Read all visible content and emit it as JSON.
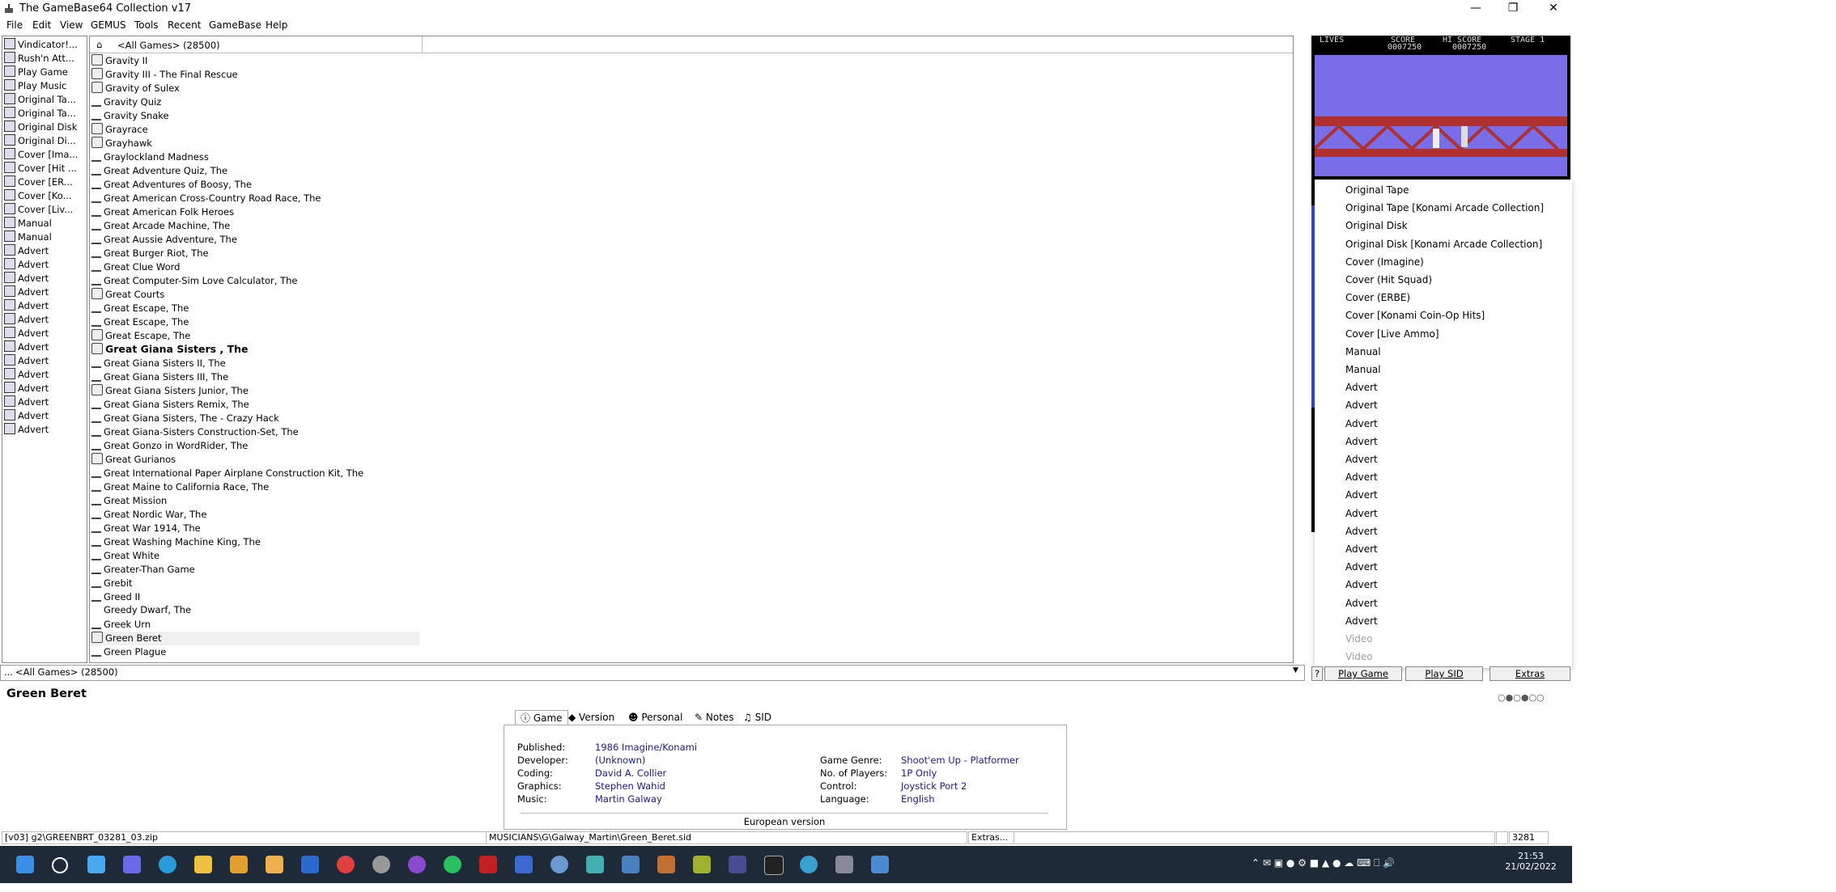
{
  "window": {
    "title": "The GameBase64 Collection v17"
  },
  "menu": [
    "File",
    "Edit",
    "View",
    "GEMUS",
    "Tools",
    "Recent",
    "GameBase",
    "Help"
  ],
  "left_items": [
    {
      "label": "Vindicator!...",
      "icon": "vindicator-icon"
    },
    {
      "label": "Rush'n Att...",
      "icon": "rush-icon"
    },
    {
      "label": "Play Game",
      "icon": "joystick-icon"
    },
    {
      "label": "Play Music",
      "icon": "music-icon"
    },
    {
      "label": "Original Ta...",
      "icon": "tape-icon"
    },
    {
      "label": "Original Ta...",
      "icon": "joystick-icon"
    },
    {
      "label": "Original Disk",
      "icon": "disk-icon"
    },
    {
      "label": "Original Di...",
      "icon": "joystick-icon"
    },
    {
      "label": "Cover [Ima...",
      "icon": "image-icon"
    },
    {
      "label": "Cover [Hit ...",
      "icon": "image-icon"
    },
    {
      "label": "Cover [ER...",
      "icon": "image-icon"
    },
    {
      "label": "Cover [Ko...",
      "icon": "image-icon"
    },
    {
      "label": "Cover [Liv...",
      "icon": "image-icon"
    },
    {
      "label": "Manual",
      "icon": "book-icon"
    },
    {
      "label": "Manual",
      "icon": "book-icon"
    },
    {
      "label": "Advert",
      "icon": "image-icon"
    },
    {
      "label": "Advert",
      "icon": "image-icon"
    },
    {
      "label": "Advert",
      "icon": "image-icon"
    },
    {
      "label": "Advert",
      "icon": "image-icon"
    },
    {
      "label": "Advert",
      "icon": "image-icon"
    },
    {
      "label": "Advert",
      "icon": "image-icon"
    },
    {
      "label": "Advert",
      "icon": "image-icon"
    },
    {
      "label": "Advert",
      "icon": "image-icon"
    },
    {
      "label": "Advert",
      "icon": "image-icon"
    },
    {
      "label": "Advert",
      "icon": "image-icon"
    },
    {
      "label": "Advert",
      "icon": "image-icon"
    },
    {
      "label": "Advert",
      "icon": "image-icon"
    },
    {
      "label": "Advert",
      "icon": "image-icon"
    },
    {
      "label": "Advert",
      "icon": "image-icon"
    }
  ],
  "gamelist": {
    "header": "<All Games>  (28500)",
    "rows": [
      {
        "title": "Gravity II",
        "icon": "disk"
      },
      {
        "title": "Gravity III - The Final Rescue",
        "icon": "disk"
      },
      {
        "title": "Gravity of Sulex",
        "icon": "disk"
      },
      {
        "title": "Gravity Quiz",
        "icon": "joy"
      },
      {
        "title": "Gravity Snake",
        "icon": "joy"
      },
      {
        "title": "Grayrace",
        "icon": "disk"
      },
      {
        "title": "Grayhawk",
        "icon": "disk"
      },
      {
        "title": "Graylockland Madness",
        "icon": "joy"
      },
      {
        "title": "Great Adventure Quiz, The",
        "icon": "joy"
      },
      {
        "title": "Great Adventures of Boosy, The",
        "icon": "joy"
      },
      {
        "title": "Great American Cross-Country Road Race, The",
        "icon": "joy"
      },
      {
        "title": "Great American Folk Heroes",
        "icon": "joy"
      },
      {
        "title": "Great Arcade Machine, The",
        "icon": "joy"
      },
      {
        "title": "Great Aussie Adventure, The",
        "icon": "joy"
      },
      {
        "title": "Great Burger Riot, The",
        "icon": "joy"
      },
      {
        "title": "Great Clue Word",
        "icon": "joy"
      },
      {
        "title": "Great Computer-Sim Love Calculator, The",
        "icon": "joy"
      },
      {
        "title": "Great Courts",
        "icon": "disk"
      },
      {
        "title": "Great Escape, The",
        "icon": "joy"
      },
      {
        "title": "Great Escape, The",
        "icon": "joy"
      },
      {
        "title": "Great Escape, The",
        "icon": "disk"
      },
      {
        "title": "Great Giana Sisters , The",
        "icon": "disk",
        "bold": true
      },
      {
        "title": "Great Giana Sisters II, The",
        "icon": "joy"
      },
      {
        "title": "Great Giana Sisters III, The",
        "icon": "joy"
      },
      {
        "title": "Great Giana Sisters Junior, The",
        "icon": "disk"
      },
      {
        "title": "Great Giana Sisters Remix, The",
        "icon": "joy"
      },
      {
        "title": "Great Giana Sisters, The - Crazy Hack",
        "icon": "joy"
      },
      {
        "title": "Great Giana-Sisters Construction-Set, The",
        "icon": "joy"
      },
      {
        "title": "Great Gonzo in WordRider, The",
        "icon": "joy"
      },
      {
        "title": "Great Gurianos",
        "icon": "disk"
      },
      {
        "title": "Great International Paper Airplane Construction Kit, The",
        "icon": "joy"
      },
      {
        "title": "Great Maine to California Race, The",
        "icon": "joy"
      },
      {
        "title": "Great Mission",
        "icon": "joy"
      },
      {
        "title": "Great Nordic War, The",
        "icon": "joy"
      },
      {
        "title": "Great War 1914, The",
        "icon": "joy"
      },
      {
        "title": "Great Washing Machine King, The",
        "icon": "joy"
      },
      {
        "title": "Great White",
        "icon": "joy"
      },
      {
        "title": "Greater-Than Game",
        "icon": "joy"
      },
      {
        "title": "Grebit",
        "icon": "joy"
      },
      {
        "title": "Greed II",
        "icon": "joy"
      },
      {
        "title": "Greedy Dwarf, The",
        "icon": "none"
      },
      {
        "title": "Greek Urn",
        "icon": "joy"
      },
      {
        "title": "Green Beret",
        "icon": "disk",
        "selected": true
      },
      {
        "title": "Green Plague",
        "icon": "joy"
      }
    ]
  },
  "filterbar": {
    "label": "<All Games>  (28500)"
  },
  "screen": {
    "hud_lives": "LIVES",
    "hud_score": "SCORE",
    "hud_hiscore": "HI  SCORE",
    "hud_stage": "STAGE 1",
    "score_value": "0007250",
    "hiscore_value": "0007250"
  },
  "extras_menu": {
    "items": [
      {
        "label": "Original Tape",
        "disabled": false
      },
      {
        "label": "Original Tape [Konami Arcade Collection]",
        "disabled": false
      },
      {
        "label": "Original Disk",
        "disabled": false
      },
      {
        "label": "Original Disk [Konami Arcade Collection]",
        "disabled": false
      },
      {
        "label": "Cover (Imagine)",
        "disabled": false
      },
      {
        "label": "Cover (Hit Squad)",
        "disabled": false
      },
      {
        "label": "Cover (ERBE)",
        "disabled": false
      },
      {
        "label": "Cover [Konami Coin-Op Hits]",
        "disabled": false
      },
      {
        "label": "Cover [Live Ammo]",
        "disabled": false
      },
      {
        "label": "Manual",
        "disabled": false
      },
      {
        "label": "Manual",
        "disabled": false
      },
      {
        "label": "Advert",
        "disabled": false
      },
      {
        "label": "Advert",
        "disabled": false
      },
      {
        "label": "Advert",
        "disabled": false
      },
      {
        "label": "Advert",
        "disabled": false
      },
      {
        "label": "Advert",
        "disabled": false
      },
      {
        "label": "Advert",
        "disabled": false
      },
      {
        "label": "Advert",
        "disabled": false
      },
      {
        "label": "Advert",
        "disabled": false
      },
      {
        "label": "Advert",
        "disabled": false
      },
      {
        "label": "Advert",
        "disabled": false
      },
      {
        "label": "Advert",
        "disabled": false
      },
      {
        "label": "Advert",
        "disabled": false
      },
      {
        "label": "Advert",
        "disabled": false
      },
      {
        "label": "Advert",
        "disabled": false
      },
      {
        "label": "Video",
        "disabled": true
      },
      {
        "label": "Video",
        "disabled": true
      }
    ]
  },
  "buttons": {
    "help": "?",
    "play_game": "Play Game",
    "play_sid": "Play SID",
    "extras": "Extras"
  },
  "game": {
    "name": "Green Beret",
    "tabs": [
      "Game",
      "Version",
      "Personal",
      "Notes",
      "SID"
    ],
    "left": [
      {
        "label": "Published:",
        "value": "1986 Imagine/Konami"
      },
      {
        "label": "Developer:",
        "value": "(Unknown)"
      },
      {
        "label": "Coding:",
        "value": "David A. Collier"
      },
      {
        "label": "Graphics:",
        "value": "Stephen Wahid"
      },
      {
        "label": "Music:",
        "value": "Martin Galway"
      }
    ],
    "right": [
      {
        "label": "Game Genre:",
        "value": "Shoot'em Up - Platformer"
      },
      {
        "label": "No. of Players:",
        "value": "1P Only"
      },
      {
        "label": "Control:",
        "value": "Joystick Port 2"
      },
      {
        "label": "Language:",
        "value": "English"
      }
    ],
    "note": "European version"
  },
  "statusbar": {
    "file": "[v03] g2\\GREENBRT_03281_03.zip",
    "sid": "MUSICIANS\\G\\Galway_Martin\\Green_Beret.sid",
    "extras": "Extras...",
    "id": "3281"
  },
  "taskbar": {
    "time": "21:53",
    "date": "21/02/2022"
  }
}
